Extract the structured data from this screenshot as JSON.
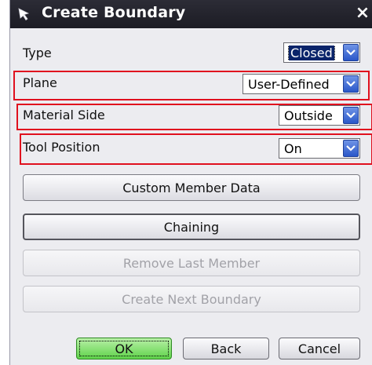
{
  "window": {
    "title": "Create Boundary",
    "close_glyph": "×",
    "title_icon": "cursor-arrow-icon"
  },
  "fields": {
    "type": {
      "label": "Type",
      "value": "Closed"
    },
    "plane": {
      "label": "Plane",
      "value": "User-Defined"
    },
    "material_side": {
      "label": "Material Side",
      "value": "Outside"
    },
    "tool_position": {
      "label": "Tool Position",
      "value": "On"
    }
  },
  "buttons": {
    "custom_member_data": "Custom Member Data",
    "chaining": "Chaining",
    "remove_last_member": "Remove Last Member",
    "create_next_boundary": "Create Next Boundary"
  },
  "footer": {
    "ok": "OK",
    "back": "Back",
    "cancel": "Cancel"
  },
  "colors": {
    "title_bar": "#1c1c24",
    "highlight": "#e0101e",
    "dropdown_arrow": "#2a57c9",
    "ok_button": "#5fd34a"
  }
}
